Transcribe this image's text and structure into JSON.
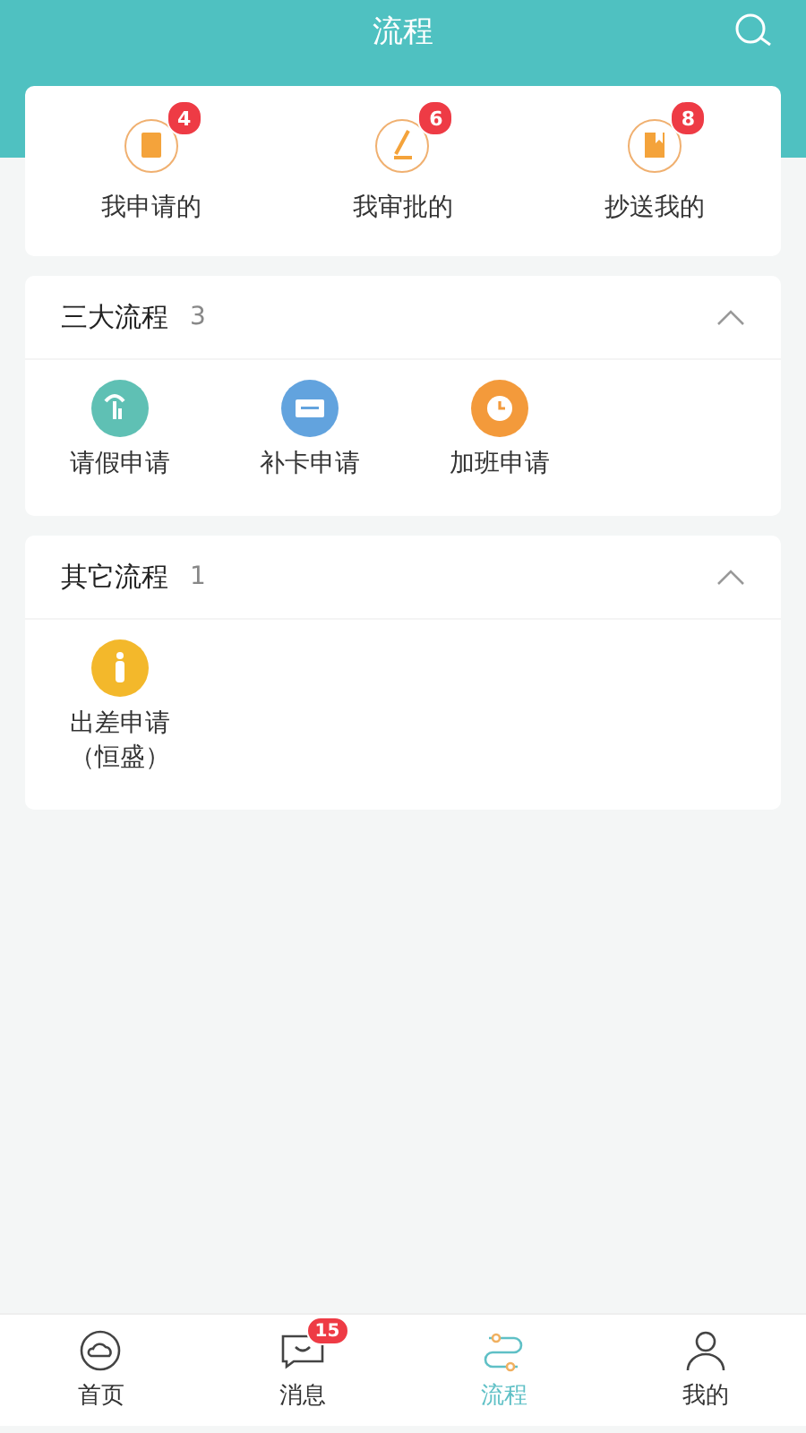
{
  "header": {
    "title": "流程"
  },
  "summary": [
    {
      "kind": "apply",
      "label": "我申请的",
      "badge": "4"
    },
    {
      "kind": "approve",
      "label": "我审批的",
      "badge": "6"
    },
    {
      "kind": "cc",
      "label": "抄送我的",
      "badge": "8"
    }
  ],
  "sections": [
    {
      "title": "三大流程",
      "count": "3",
      "expanded": true,
      "items": [
        {
          "kind": "leave",
          "label": "请假申请",
          "color": "#5fc0b4"
        },
        {
          "kind": "card",
          "label": "补卡申请",
          "color": "#62a3de"
        },
        {
          "kind": "overtime",
          "label": "加班申请",
          "color": "#f39a3b"
        }
      ]
    },
    {
      "title": "其它流程",
      "count": "1",
      "expanded": true,
      "items": [
        {
          "kind": "travel",
          "label": "出差申请（恒盛）",
          "color": "#f3b82b"
        }
      ]
    }
  ],
  "nav": [
    {
      "kind": "home",
      "label": "首页",
      "selected": false
    },
    {
      "kind": "message",
      "label": "消息",
      "selected": false,
      "badge": "15"
    },
    {
      "kind": "flow",
      "label": "流程",
      "selected": true
    },
    {
      "kind": "me",
      "label": "我的",
      "selected": false
    }
  ]
}
